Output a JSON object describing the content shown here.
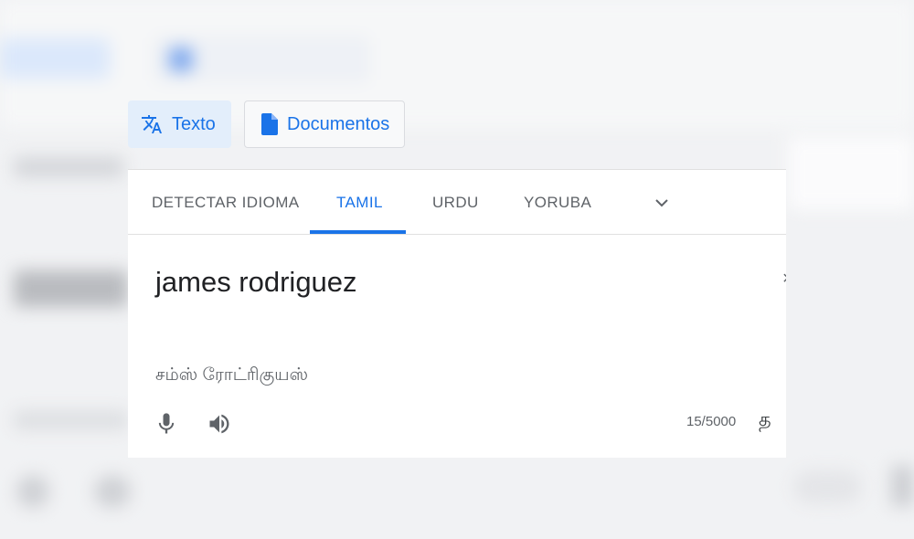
{
  "modes": {
    "text_label": "Texto",
    "documents_label": "Documentos"
  },
  "languages": {
    "items": [
      "DETECTAR IDIOMA",
      "TAMIL",
      "URDU",
      "YORUBA"
    ],
    "active": "TAMIL",
    "more_icon": "chevron-down-icon"
  },
  "editor": {
    "source_text": "james rodriguez",
    "transliteration": "சம்ஸ் ரோட்ரிகுயஸ்",
    "char_count": "15/5000",
    "input_tool_glyph": "த"
  },
  "colors": {
    "accent": "#1a73e8",
    "active_tab_bg": "#e3eefb",
    "text_primary": "#202124",
    "text_secondary": "#5f6368"
  },
  "icons": [
    "translate-icon",
    "document-icon",
    "chevron-down-icon",
    "microphone-icon",
    "speaker-icon"
  ]
}
